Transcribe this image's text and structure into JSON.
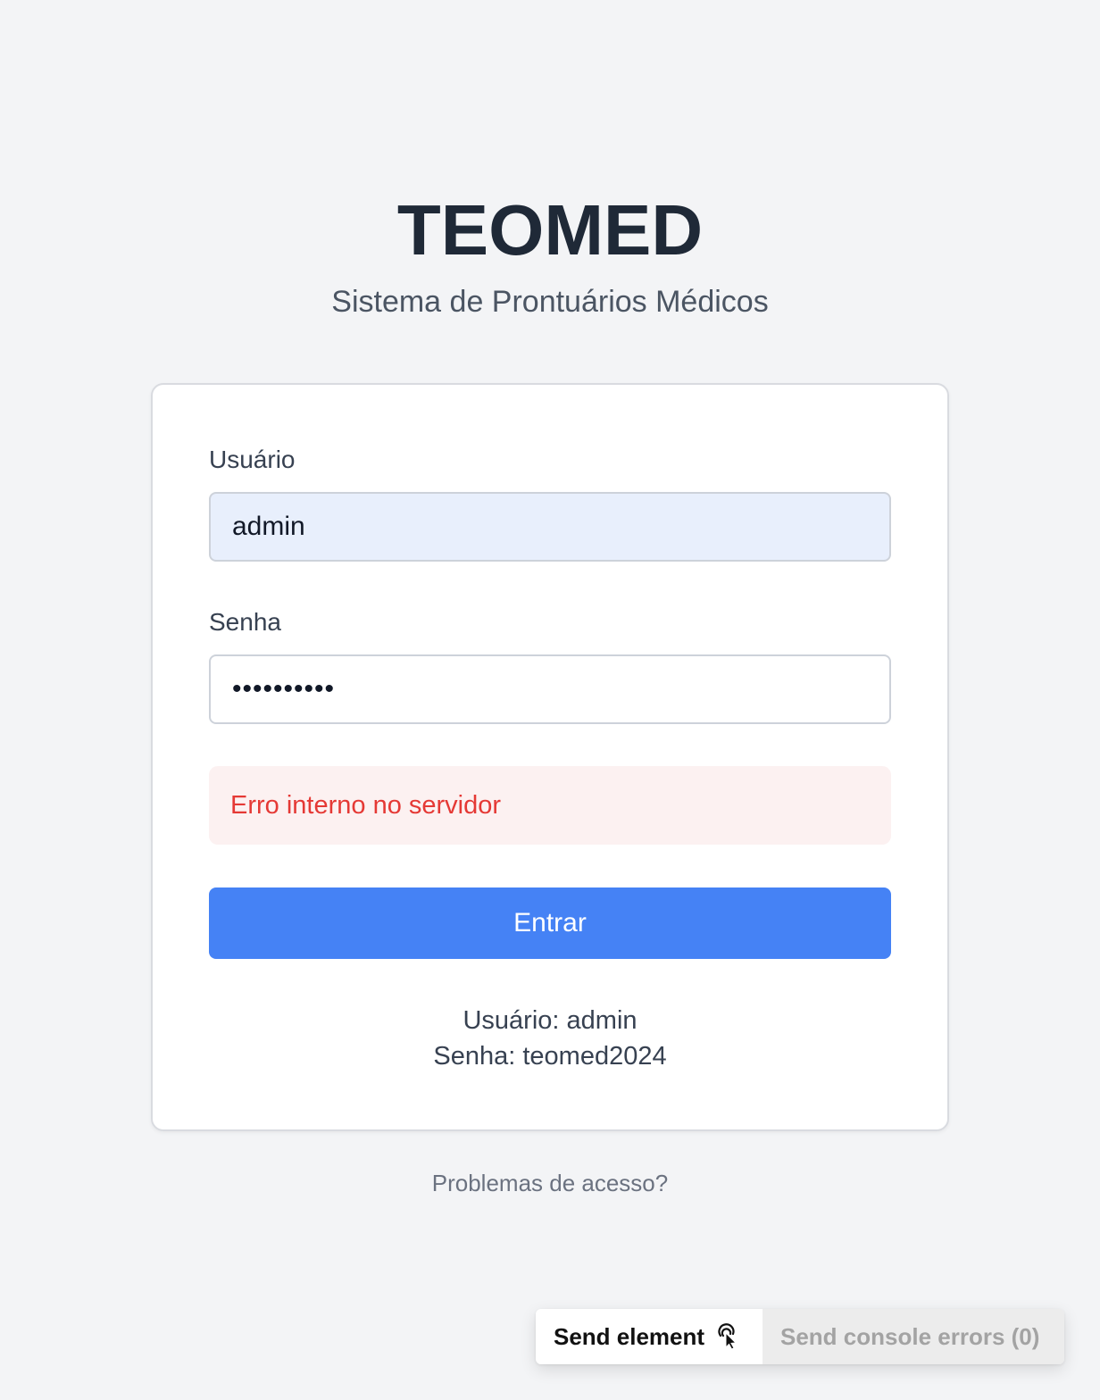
{
  "brand": {
    "title": "TEOMED",
    "subtitle": "Sistema de Prontuários Médicos"
  },
  "login_form": {
    "username_label": "Usuário",
    "username_value": "admin",
    "password_label": "Senha",
    "password_value": "••••••••••",
    "error_message": "Erro interno no servidor",
    "submit_label": "Entrar",
    "hint_username": "Usuário: admin",
    "hint_password": "Senha: teomed2024"
  },
  "footer": {
    "access_link": "Problemas de acesso?"
  },
  "dev_toolbar": {
    "send_element_label": "Send element",
    "send_element_icon": "pointer-click-icon",
    "send_errors_label": "Send console errors (0)"
  },
  "colors": {
    "background": "#f3f4f6",
    "primary_button": "#4582f5",
    "error_text": "#e53935",
    "error_background": "#fcf1f1",
    "autofill_background": "#e8effc"
  }
}
